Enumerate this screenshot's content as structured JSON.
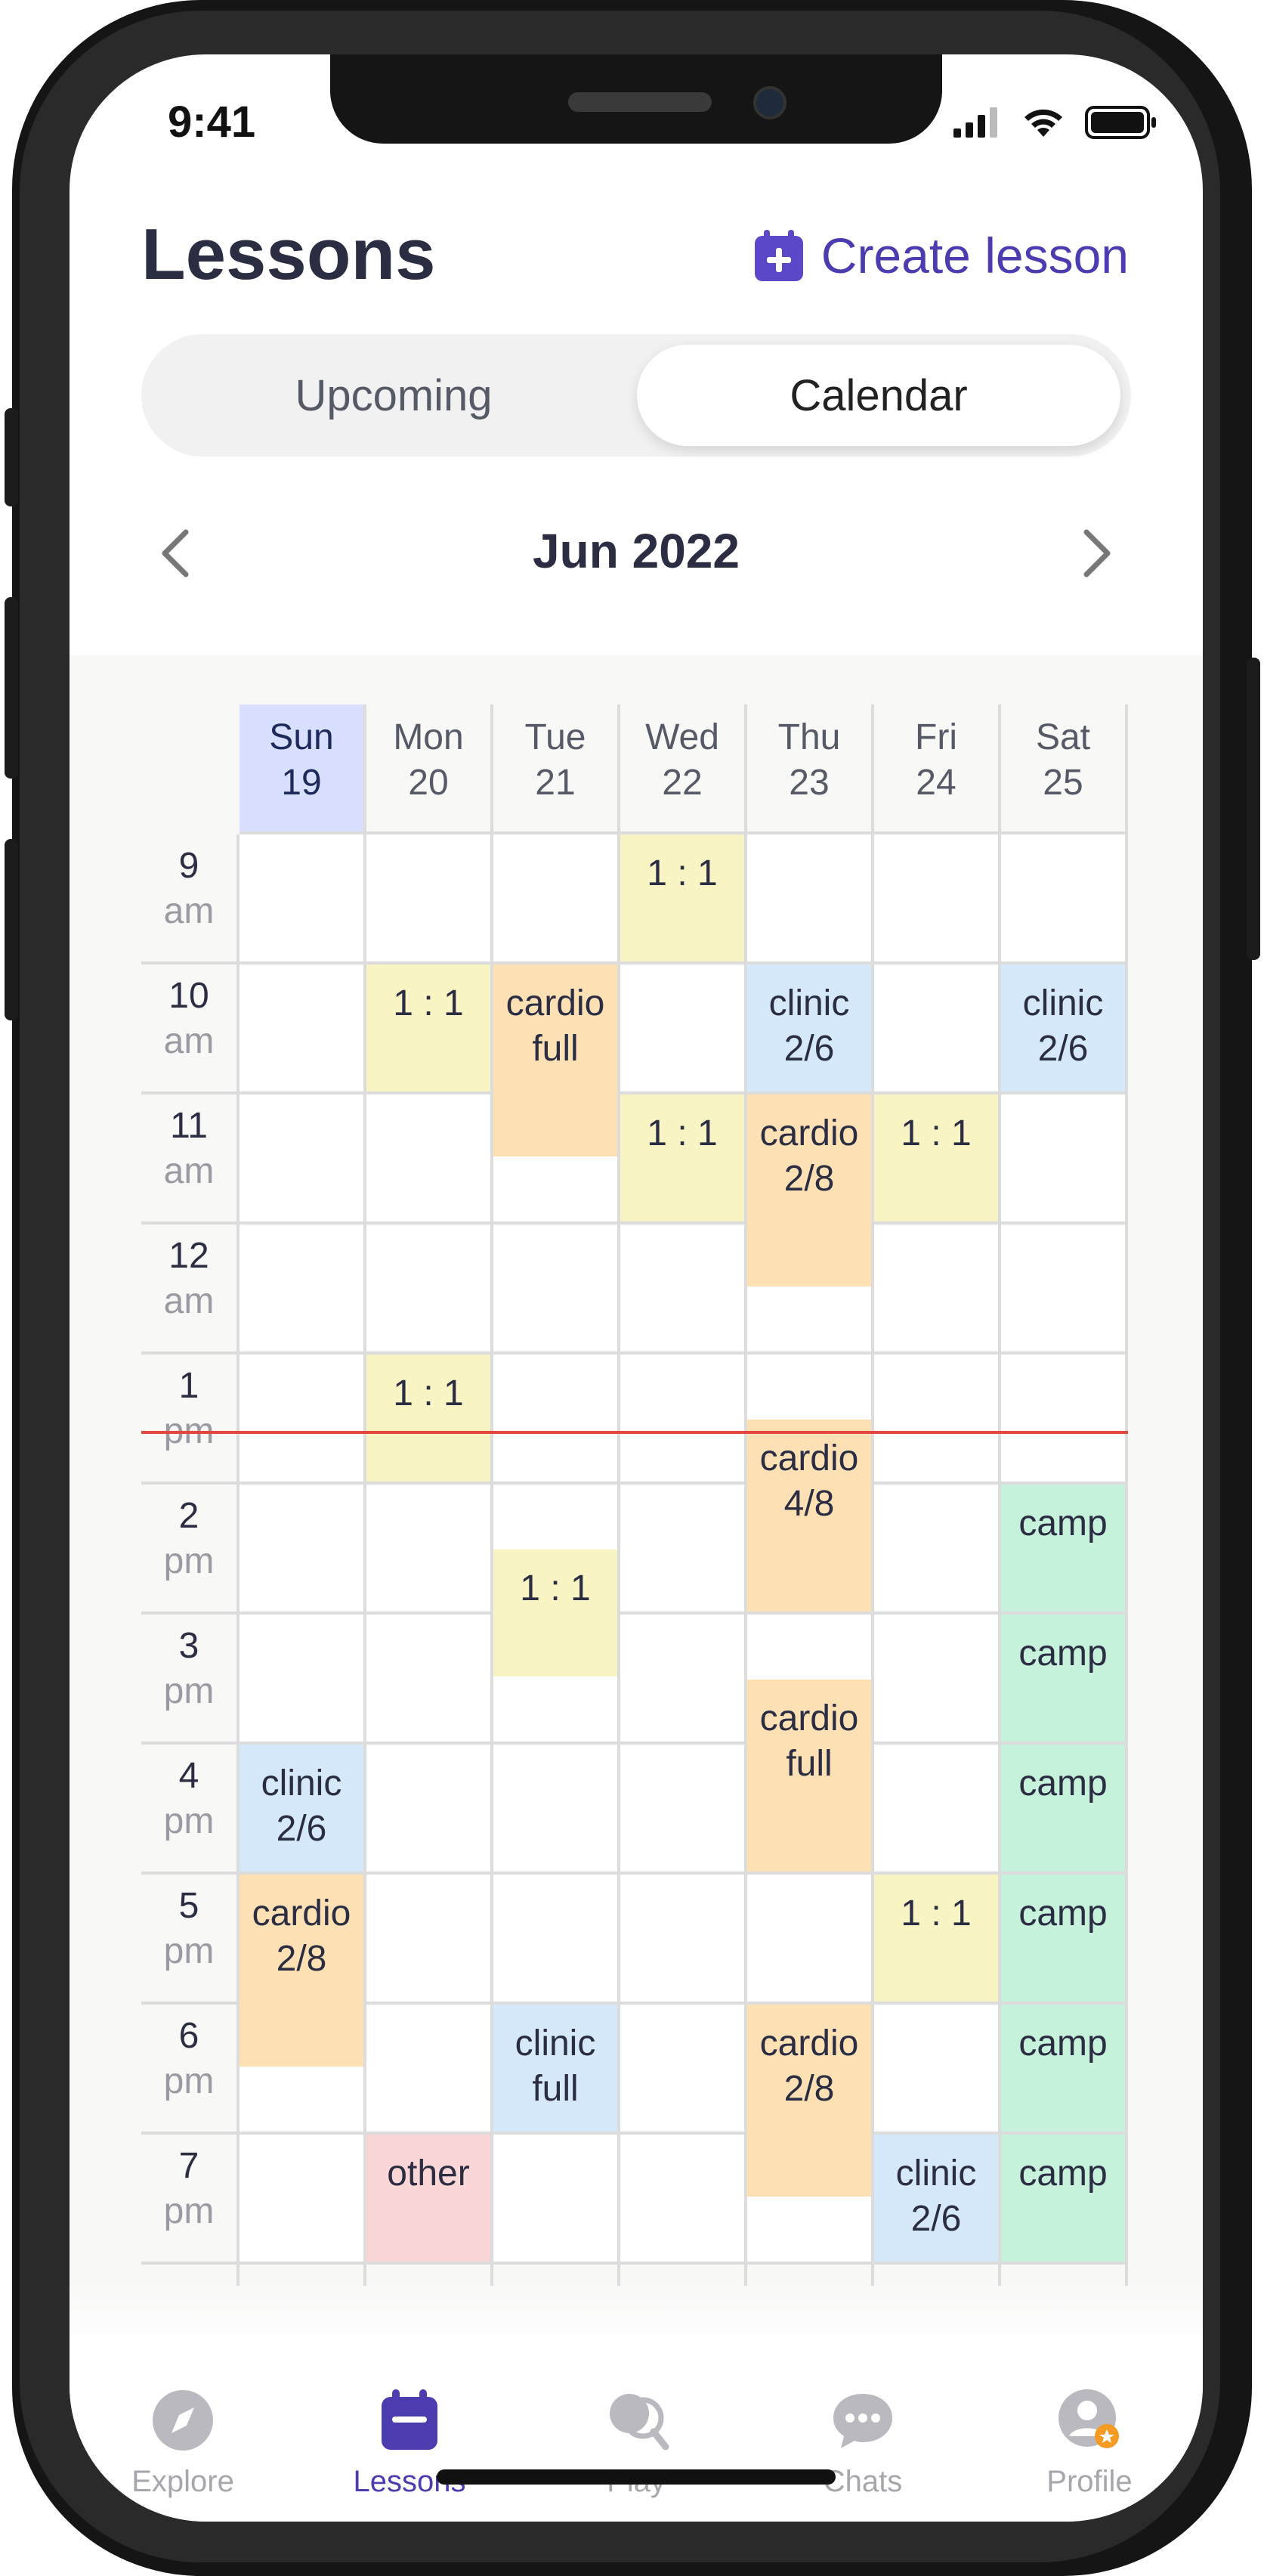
{
  "status": {
    "time": "9:41"
  },
  "header": {
    "title": "Lessons",
    "create_label": "Create lesson"
  },
  "segments": {
    "upcoming": "Upcoming",
    "calendar": "Calendar"
  },
  "month": {
    "label": "Jun 2022"
  },
  "calendar": {
    "days": [
      {
        "name": "Sun",
        "date": "19",
        "today": true
      },
      {
        "name": "Mon",
        "date": "20"
      },
      {
        "name": "Tue",
        "date": "21"
      },
      {
        "name": "Wed",
        "date": "22"
      },
      {
        "name": "Thu",
        "date": "23"
      },
      {
        "name": "Fri",
        "date": "24"
      },
      {
        "name": "Sat",
        "date": "25"
      }
    ],
    "hours": [
      {
        "h": "9",
        "p": "am"
      },
      {
        "h": "10",
        "p": "am"
      },
      {
        "h": "11",
        "p": "am"
      },
      {
        "h": "12",
        "p": "am"
      },
      {
        "h": "1",
        "p": "pm"
      },
      {
        "h": "2",
        "p": "pm"
      },
      {
        "h": "3",
        "p": "pm"
      },
      {
        "h": "4",
        "p": "pm"
      },
      {
        "h": "5",
        "p": "pm"
      },
      {
        "h": "6",
        "p": "pm"
      },
      {
        "h": "7",
        "p": "pm"
      }
    ],
    "current_time_hours": 13.6,
    "events": [
      {
        "day": 3,
        "start": 9,
        "duration": 1,
        "color": "yellow",
        "lines": [
          "1 : 1"
        ]
      },
      {
        "day": 1,
        "start": 10,
        "duration": 1,
        "color": "yellow",
        "lines": [
          "1 : 1"
        ]
      },
      {
        "day": 2,
        "start": 10,
        "duration": 1.5,
        "color": "orange",
        "lines": [
          "cardio",
          "full"
        ]
      },
      {
        "day": 4,
        "start": 10,
        "duration": 1,
        "color": "blue",
        "lines": [
          "clinic",
          "2/6"
        ]
      },
      {
        "day": 6,
        "start": 10,
        "duration": 1,
        "color": "blue",
        "lines": [
          "clinic",
          "2/6"
        ]
      },
      {
        "day": 3,
        "start": 11,
        "duration": 1,
        "color": "yellow",
        "lines": [
          "1 : 1"
        ]
      },
      {
        "day": 4,
        "start": 11,
        "duration": 1.5,
        "color": "orange",
        "lines": [
          "cardio",
          "2/8"
        ]
      },
      {
        "day": 5,
        "start": 11,
        "duration": 1,
        "color": "yellow",
        "lines": [
          "1 : 1"
        ]
      },
      {
        "day": 1,
        "start": 13,
        "duration": 1,
        "color": "yellow",
        "lines": [
          "1 : 1"
        ]
      },
      {
        "day": 4,
        "start": 13.5,
        "duration": 1.5,
        "color": "orange",
        "lines": [
          "cardio",
          "4/8"
        ]
      },
      {
        "day": 2,
        "start": 14.5,
        "duration": 1,
        "color": "yellow",
        "lines": [
          "1 : 1"
        ]
      },
      {
        "day": 4,
        "start": 15.5,
        "duration": 1.5,
        "color": "orange",
        "lines": [
          "cardio",
          "full"
        ]
      },
      {
        "day": 0,
        "start": 16,
        "duration": 1,
        "color": "blue",
        "lines": [
          "clinic",
          "2/6"
        ]
      },
      {
        "day": 0,
        "start": 17,
        "duration": 1.5,
        "color": "orange",
        "lines": [
          "cardio",
          "2/8"
        ]
      },
      {
        "day": 5,
        "start": 17,
        "duration": 1,
        "color": "yellow",
        "lines": [
          "1 : 1"
        ]
      },
      {
        "day": 2,
        "start": 18,
        "duration": 1,
        "color": "blue",
        "lines": [
          "clinic",
          "full"
        ]
      },
      {
        "day": 4,
        "start": 18,
        "duration": 1.5,
        "color": "orange",
        "lines": [
          "cardio",
          "2/8"
        ]
      },
      {
        "day": 1,
        "start": 19,
        "duration": 1,
        "color": "pink",
        "lines": [
          "other"
        ]
      },
      {
        "day": 5,
        "start": 19,
        "duration": 1,
        "color": "blue",
        "lines": [
          "clinic",
          "2/6"
        ]
      },
      {
        "day": 6,
        "start": 14,
        "duration": 1,
        "color": "green",
        "lines": [
          "camp"
        ]
      },
      {
        "day": 6,
        "start": 15,
        "duration": 1,
        "color": "green",
        "lines": [
          "camp"
        ]
      },
      {
        "day": 6,
        "start": 16,
        "duration": 1,
        "color": "green",
        "lines": [
          "camp"
        ]
      },
      {
        "day": 6,
        "start": 17,
        "duration": 1,
        "color": "green",
        "lines": [
          "camp"
        ]
      },
      {
        "day": 6,
        "start": 18,
        "duration": 1,
        "color": "green",
        "lines": [
          "camp"
        ]
      },
      {
        "day": 6,
        "start": 19,
        "duration": 1,
        "color": "green",
        "lines": [
          "camp"
        ]
      }
    ]
  },
  "tabs": [
    {
      "label": "Explore",
      "icon": "compass-icon"
    },
    {
      "label": "Lessons",
      "icon": "calendar-icon",
      "active": true
    },
    {
      "label": "Play",
      "icon": "racket-icon"
    },
    {
      "label": "Chats",
      "icon": "chat-bubble-icon"
    },
    {
      "label": "Profile",
      "icon": "profile-badge-icon"
    }
  ],
  "colors": {
    "accent": "#4b3cb0",
    "today_header": "#d9e0ff",
    "now_line": "#e3483e"
  }
}
